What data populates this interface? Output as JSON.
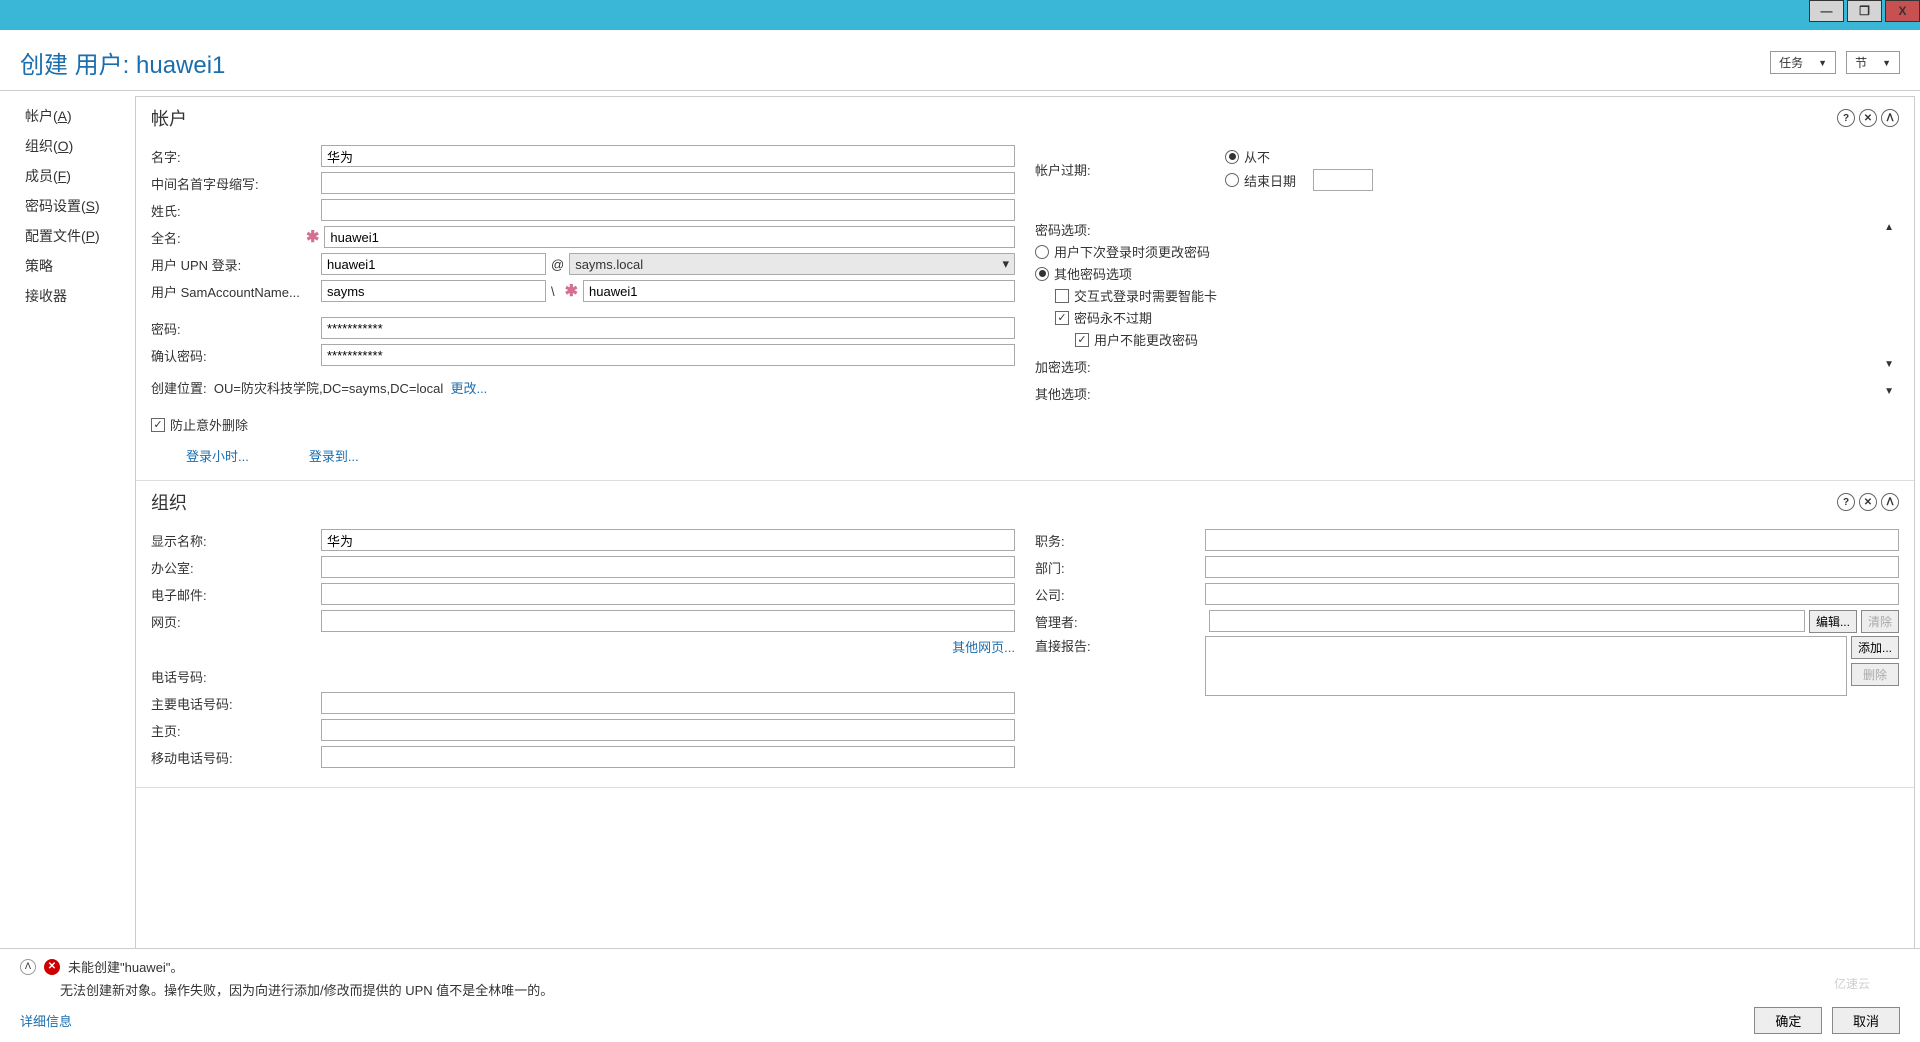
{
  "titlebar": {
    "min": "—",
    "max": "❐",
    "close": "X"
  },
  "header": {
    "title": "创建 用户: huawei1",
    "tasks": "任务",
    "sections": "节"
  },
  "sidebar": {
    "items": [
      {
        "label": "帐户",
        "key": "A"
      },
      {
        "label": "组织",
        "key": "O"
      },
      {
        "label": "成员",
        "key": "F"
      },
      {
        "label": "密码设置",
        "key": "S"
      },
      {
        "label": "配置文件",
        "key": "P"
      },
      {
        "label": "策略",
        "key": ""
      },
      {
        "label": "接收器",
        "key": ""
      }
    ]
  },
  "account": {
    "title": "帐户",
    "first_name_lbl": "名字:",
    "first_name": "华为",
    "initials_lbl": "中间名首字母缩写:",
    "last_name_lbl": "姓氏:",
    "full_name_lbl": "全名:",
    "full_name": "huawei1",
    "upn_lbl": "用户 UPN 登录:",
    "upn": "huawei1",
    "at": "@",
    "domain": "sayms.local",
    "sam_lbl": "用户 SamAccountName...",
    "sam_domain": "sayms",
    "backslash": "\\",
    "sam": "huawei1",
    "password_lbl": "密码:",
    "password": "***********",
    "confirm_lbl": "确认密码:",
    "confirm": "***********",
    "location_lbl": "创建位置:",
    "location": "OU=防灾科技学院,DC=sayms,DC=local",
    "change": "更改...",
    "prevent_delete": "防止意外删除",
    "logon_hours": "登录小时...",
    "logon_to": "登录到...",
    "expiry_lbl": "帐户过期:",
    "never": "从不",
    "end_date": "结束日期",
    "pwd_options_lbl": "密码选项:",
    "must_change": "用户下次登录时须更改密码",
    "other_pwd": "其他密码选项",
    "smartcard": "交互式登录时需要智能卡",
    "pwd_never_expires": "密码永不过期",
    "cannot_change": "用户不能更改密码",
    "encrypt_lbl": "加密选项:",
    "other_lbl": "其他选项:"
  },
  "org": {
    "title": "组织",
    "display_lbl": "显示名称:",
    "display": "华为",
    "office_lbl": "办公室:",
    "email_lbl": "电子邮件:",
    "web_lbl": "网页:",
    "other_web": "其他网页...",
    "phone_lbl": "电话号码:",
    "main_phone_lbl": "主要电话号码:",
    "home_lbl": "主页:",
    "mobile_lbl": "移动电话号码:",
    "job_lbl": "职务:",
    "dept_lbl": "部门:",
    "company_lbl": "公司:",
    "manager_lbl": "管理者:",
    "edit": "编辑...",
    "clear": "清除",
    "reports_lbl": "直接报告:",
    "add": "添加...",
    "remove": "删除"
  },
  "status": {
    "error_title": "未能创建\"huawei\"。",
    "error_msg": "无法创建新对象。操作失败，因为向进行添加/修改而提供的 UPN 值不是全林唯一的。",
    "details": "详细信息",
    "ok": "确定",
    "cancel": "取消"
  },
  "watermark": "亿速云"
}
